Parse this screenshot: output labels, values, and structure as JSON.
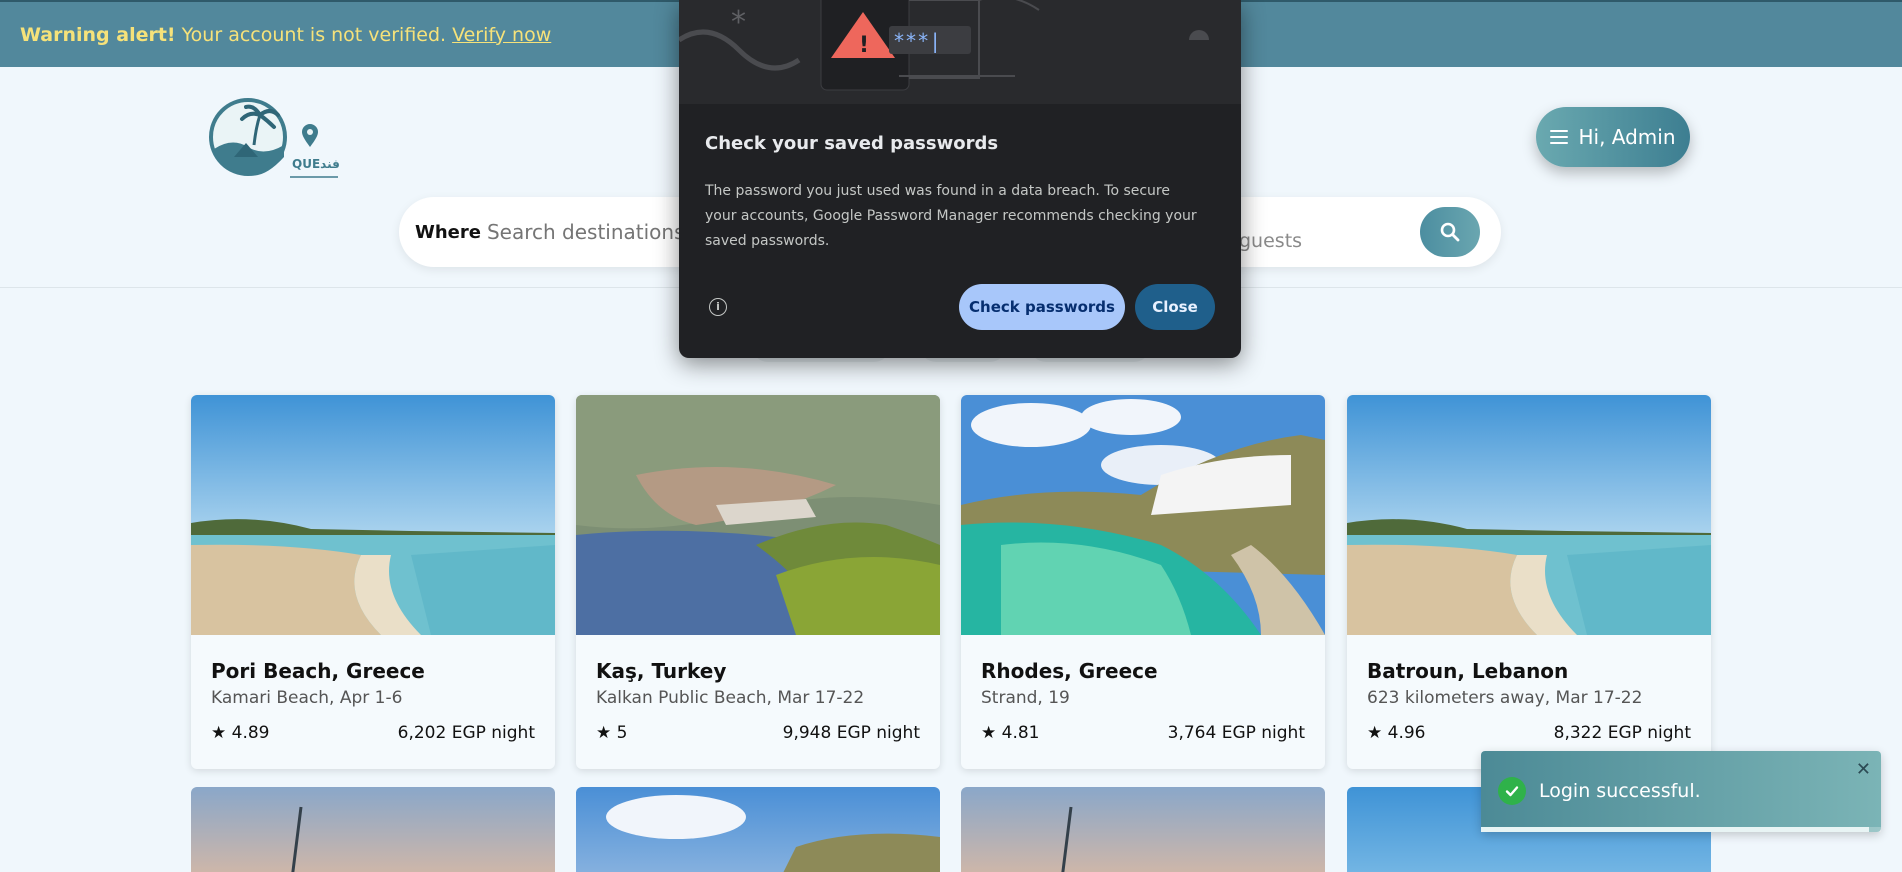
{
  "warning": {
    "bold": "Warning alert!",
    "text": "Your account is not verified.",
    "link": "Verify now"
  },
  "header": {
    "logo_text": "QUEفند",
    "admin_label": "Hi, Admin",
    "search": {
      "where_label": "Where",
      "placeholder": "Search destinations",
      "guests_placeholder": "guests"
    }
  },
  "listings": [
    {
      "title": "Pori Beach, Greece",
      "subtitle": "Kamari Beach, Apr 1-6",
      "rating": "★ 4.89",
      "price": "6,202 EGP night",
      "image": "beach"
    },
    {
      "title": "Kaş, Turkey",
      "subtitle": "Kalkan Public Beach, Mar 17-22",
      "rating": "★ 5",
      "price": "9,948 EGP night",
      "image": "bay"
    },
    {
      "title": "Rhodes, Greece",
      "subtitle": "Strand, 19",
      "rating": "★ 4.81",
      "price": "3,764 EGP night",
      "image": "lagoon"
    },
    {
      "title": "Batroun, Lebanon",
      "subtitle": "623 kilometers away, Mar 17-22",
      "rating": "★ 4.96",
      "price": "8,322 EGP night",
      "image": "beach"
    }
  ],
  "popup": {
    "title": "Check your saved passwords",
    "body": "The password you just used was found in a data breach. To secure your accounts, Google Password Manager recommends checking your saved passwords.",
    "info_icon": "info-icon",
    "check_label": "Check passwords",
    "close_label": "Close",
    "art_password": "***|"
  },
  "toast": {
    "message": "Login successful.",
    "close": "✕",
    "progress": 0.97
  },
  "colors": {
    "warning_bg": "#52889c",
    "warning_text": "#f6e27a",
    "accent": "#4c8ea0",
    "popup_bg": "#202124",
    "check_btn": "#a8c7fa",
    "close_btn": "#1f5f8b",
    "toast_check": "#2fb24a"
  }
}
